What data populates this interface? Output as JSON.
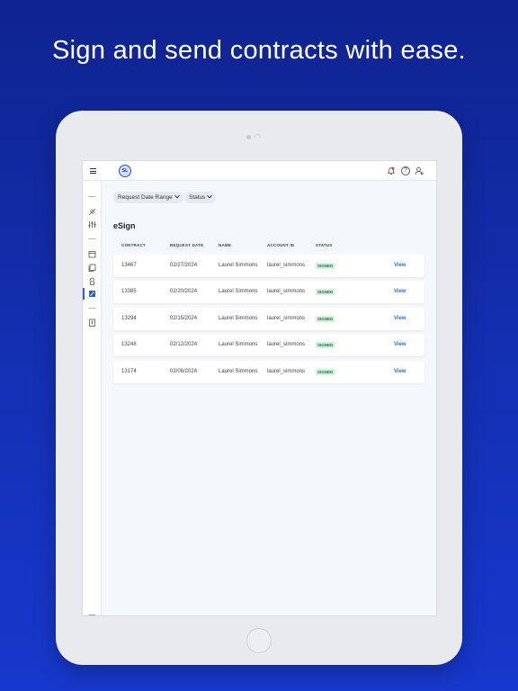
{
  "headline": "Sign and send contracts with ease.",
  "app": {
    "logo_text": "SL",
    "topbar": {
      "menu_icon": "hamburger-icon",
      "icons": [
        "bell-icon",
        "help-icon",
        "user-icon"
      ],
      "help_glyph": "?"
    },
    "filters": [
      {
        "label": "Request Date Range"
      },
      {
        "label": "Status"
      }
    ],
    "page_title": "eSign",
    "table": {
      "columns": [
        "CONTRACT",
        "REQUEST DATE",
        "NAME",
        "ACCOUNT ID",
        "STATUS"
      ],
      "rows": [
        {
          "contract": "13467",
          "date": "02/27/2024",
          "name": "Laurel Simmons",
          "account": "laurel_simmons",
          "status": "SIGNED",
          "action": "View"
        },
        {
          "contract": "13385",
          "date": "02/20/2024",
          "name": "Laurel Simmons",
          "account": "laurel_simmons",
          "status": "SIGNED",
          "action": "View"
        },
        {
          "contract": "13294",
          "date": "02/15/2024",
          "name": "Laurel Simmons",
          "account": "laurel_simmons",
          "status": "SIGNED",
          "action": "View"
        },
        {
          "contract": "13248",
          "date": "02/12/2024",
          "name": "Laurel Simmons",
          "account": "laurel_simmons",
          "status": "SIGNED",
          "action": "View"
        },
        {
          "contract": "13174",
          "date": "02/08/2024",
          "name": "Laurel Simmons",
          "account": "laurel_simmons",
          "status": "SIGNED",
          "action": "View"
        }
      ]
    },
    "colors": {
      "accent": "#2a73d9",
      "signed_bg": "#d3f0dc",
      "signed_text": "#1f7a3d",
      "notification": "#e53935"
    }
  }
}
